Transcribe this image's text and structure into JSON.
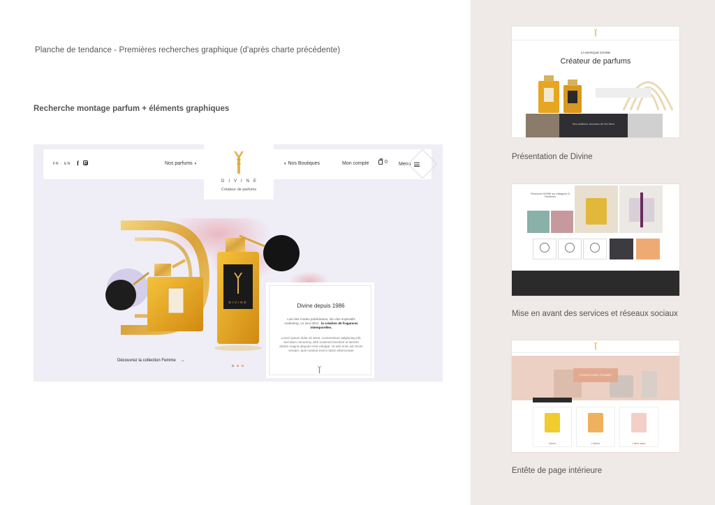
{
  "board": {
    "title": "Planche de tendance - Premières recherches graphique (d'après charte précédente)",
    "subtitle": "Recherche montage parfum + éléments graphiques"
  },
  "main_mockup": {
    "nav": {
      "lang": "FR · EN",
      "nos_parfums": "Nos parfums",
      "nos_boutiques": "Nos Boutiques",
      "mon_compte": "Mon compte",
      "cart_count": "0",
      "menu": "Menu"
    },
    "logo": {
      "word": "DIVINE",
      "tagline": "Créateur de parfums"
    },
    "hero": {
      "discover": "Découvrez la collection Femme",
      "arrow": "→"
    },
    "card": {
      "title": "Divine depuis 1986",
      "p1_a": "Loin des modes publicitaires, loin des impératifs marketing, un seul désir : ",
      "p1_b": "la création de fragances intemporelles.",
      "p2": "Lorem ipsum dolor sit amet, consectetuer adipiscing elit, sed diam nonummy nibh euismod tincidunt ut laoreet dolore magna aliquam erat volutpat. Ut wisi enim ad minim veniam, quis nostrud exerci tation ullamcorper"
    },
    "bottle_label": "DIVINE",
    "colors": {
      "gold": "#e3b34a",
      "pink": "#eab3bd",
      "background": "#efedf6",
      "accent_dot": "#e9a679"
    }
  },
  "thumbnails": {
    "t1": {
      "caption": "Présentation de Divine",
      "kicker": "LA MARQUE DIVINE",
      "heading": "Créateur de parfums",
      "band_text": "Nos créations, berceaux de l'Art Déco"
    },
    "t2": {
      "caption": "Mise en avant des services et réseaux sociaux",
      "heading": "Retrouvez DIVINE sur Instagram & Facebook"
    },
    "t3": {
      "caption": "Entête de page intérieure",
      "banner": "CRÉATIONS FEMME",
      "products": [
        "Divine",
        "L'infinie",
        "L'âme sœur"
      ]
    }
  }
}
